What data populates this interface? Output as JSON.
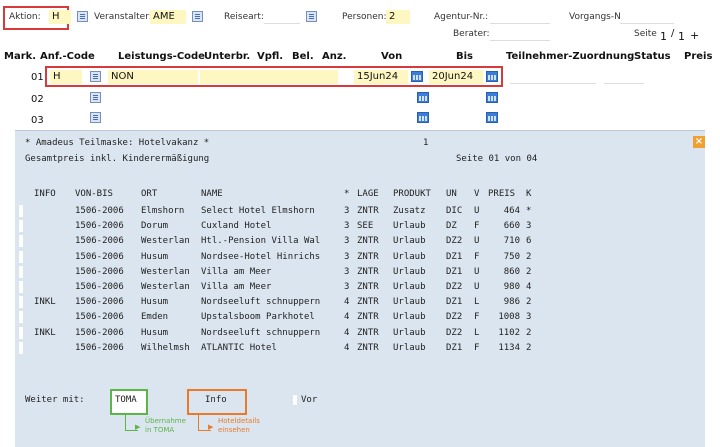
{
  "top": {
    "aktion_label": "Aktion:",
    "aktion_value": "H",
    "veranstalter_label": "Veranstalter:",
    "veranstalter_value": "AME",
    "reiseart_label": "Reiseart:",
    "personen_label": "Personen:",
    "personen_value": "2",
    "agentur_label": "Agentur-Nr.:",
    "vorgangs_label": "Vorgangs-Nr.:",
    "berater_label": "Berater:",
    "seite_label": "Seite",
    "seite_current": "1",
    "seite_sep": "/",
    "seite_total": "1",
    "seite_plus": "+"
  },
  "table": {
    "headers": [
      "Mark.",
      "Anf.-Code",
      "Leistungs-Code",
      "Unterbr.",
      "Vpfl.",
      "Bel.",
      "Anz.",
      "Von",
      "Bis",
      "Teilnehmer-Zuordnung",
      "Status",
      "Preis"
    ],
    "rows": [
      {
        "num": "01",
        "code": "H",
        "leistung": "NON",
        "von": "15Jun24",
        "bis": "20Jun24"
      },
      {
        "num": "02",
        "code": "",
        "leistung": "",
        "von": "",
        "bis": ""
      },
      {
        "num": "03",
        "code": "",
        "leistung": "",
        "von": "",
        "bis": ""
      }
    ]
  },
  "panel": {
    "title": "* Amadeus Teilmaske: Hotelvakanz *",
    "page_indicator": "1",
    "subtitle": "Gesamtpreis inkl. Kinderermäßigung",
    "page_info": "Seite 01 von 04",
    "columns": {
      "info": "INFO",
      "vonbis": "VON-BIS",
      "ort": "ORT",
      "name": "NAME",
      "star": "*",
      "lage": "LAGE",
      "produkt": "PRODUKT",
      "un": "UN",
      "v": "V",
      "preis": "PREIS",
      "k": "K"
    },
    "results": [
      {
        "info": "",
        "vonbis": "1506-2006",
        "ort": "Elmshorn",
        "name": "Select Hotel Elmshorn",
        "star": "3",
        "lage": "ZNTR",
        "produkt": "Zusatz",
        "un": "DIC",
        "v": "U",
        "preis": "464",
        "k": "*"
      },
      {
        "info": "",
        "vonbis": "1506-2006",
        "ort": "Dorum",
        "name": "Cuxland Hotel",
        "star": "3",
        "lage": "SEE",
        "produkt": "Urlaub",
        "un": "DZ",
        "v": "F",
        "preis": "660",
        "k": "3"
      },
      {
        "info": "",
        "vonbis": "1506-2006",
        "ort": "Westerlan",
        "name": "Htl.-Pension Villa Wal",
        "star": "3",
        "lage": "ZNTR",
        "produkt": "Urlaub",
        "un": "DZ2",
        "v": "U",
        "preis": "710",
        "k": "6"
      },
      {
        "info": "",
        "vonbis": "1506-2006",
        "ort": "Husum",
        "name": "Nordsee-Hotel Hinrichs",
        "star": "3",
        "lage": "ZNTR",
        "produkt": "Urlaub",
        "un": "DZ1",
        "v": "F",
        "preis": "750",
        "k": "2"
      },
      {
        "info": "",
        "vonbis": "1506-2006",
        "ort": "Westerlan",
        "name": "Villa am Meer",
        "star": "3",
        "lage": "ZNTR",
        "produkt": "Urlaub",
        "un": "DZ1",
        "v": "U",
        "preis": "860",
        "k": "2"
      },
      {
        "info": "",
        "vonbis": "1506-2006",
        "ort": "Westerlan",
        "name": "Villa am Meer",
        "star": "3",
        "lage": "ZNTR",
        "produkt": "Urlaub",
        "un": "DZ2",
        "v": "U",
        "preis": "980",
        "k": "4"
      },
      {
        "info": "INKL",
        "vonbis": "1506-2006",
        "ort": "Husum",
        "name": "Nordseeluft schnuppern",
        "star": "4",
        "lage": "ZNTR",
        "produkt": "Urlaub",
        "un": "DZ1",
        "v": "L",
        "preis": "986",
        "k": "2"
      },
      {
        "info": "",
        "vonbis": "1506-2006",
        "ort": "Emden",
        "name": "Upstalsboom Parkhotel",
        "star": "4",
        "lage": "ZNTR",
        "produkt": "Urlaub",
        "un": "DZ2",
        "v": "F",
        "preis": "1008",
        "k": "3"
      },
      {
        "info": "INKL",
        "vonbis": "1506-2006",
        "ort": "Husum",
        "name": "Nordseeluft schnuppern",
        "star": "4",
        "lage": "ZNTR",
        "produkt": "Urlaub",
        "un": "DZ2",
        "v": "L",
        "preis": "1102",
        "k": "2"
      },
      {
        "info": "",
        "vonbis": "1506-2006",
        "ort": "Wilhelmsh",
        "name": "ATLANTIC Hotel",
        "star": "4",
        "lage": "ZNTR",
        "produkt": "Urlaub",
        "un": "DZ1",
        "v": "F",
        "preis": "1134",
        "k": "2"
      }
    ],
    "weiter_label": "Weiter mit:",
    "weiter_toma": "TOMA",
    "weiter_info": "Info",
    "weiter_vor": "Vor",
    "annotation_toma_line1": "Übernahme",
    "annotation_toma_line2": "in TOMA",
    "annotation_info_line1": "Hoteldetails",
    "annotation_info_line2": "einsehen"
  },
  "colors": {
    "highlight_red": "#d63a3a",
    "toma_green": "#5cb547",
    "info_orange": "#e87a2a",
    "panel_bg": "#dae5ef",
    "field_yellow": "#fff7c2"
  }
}
